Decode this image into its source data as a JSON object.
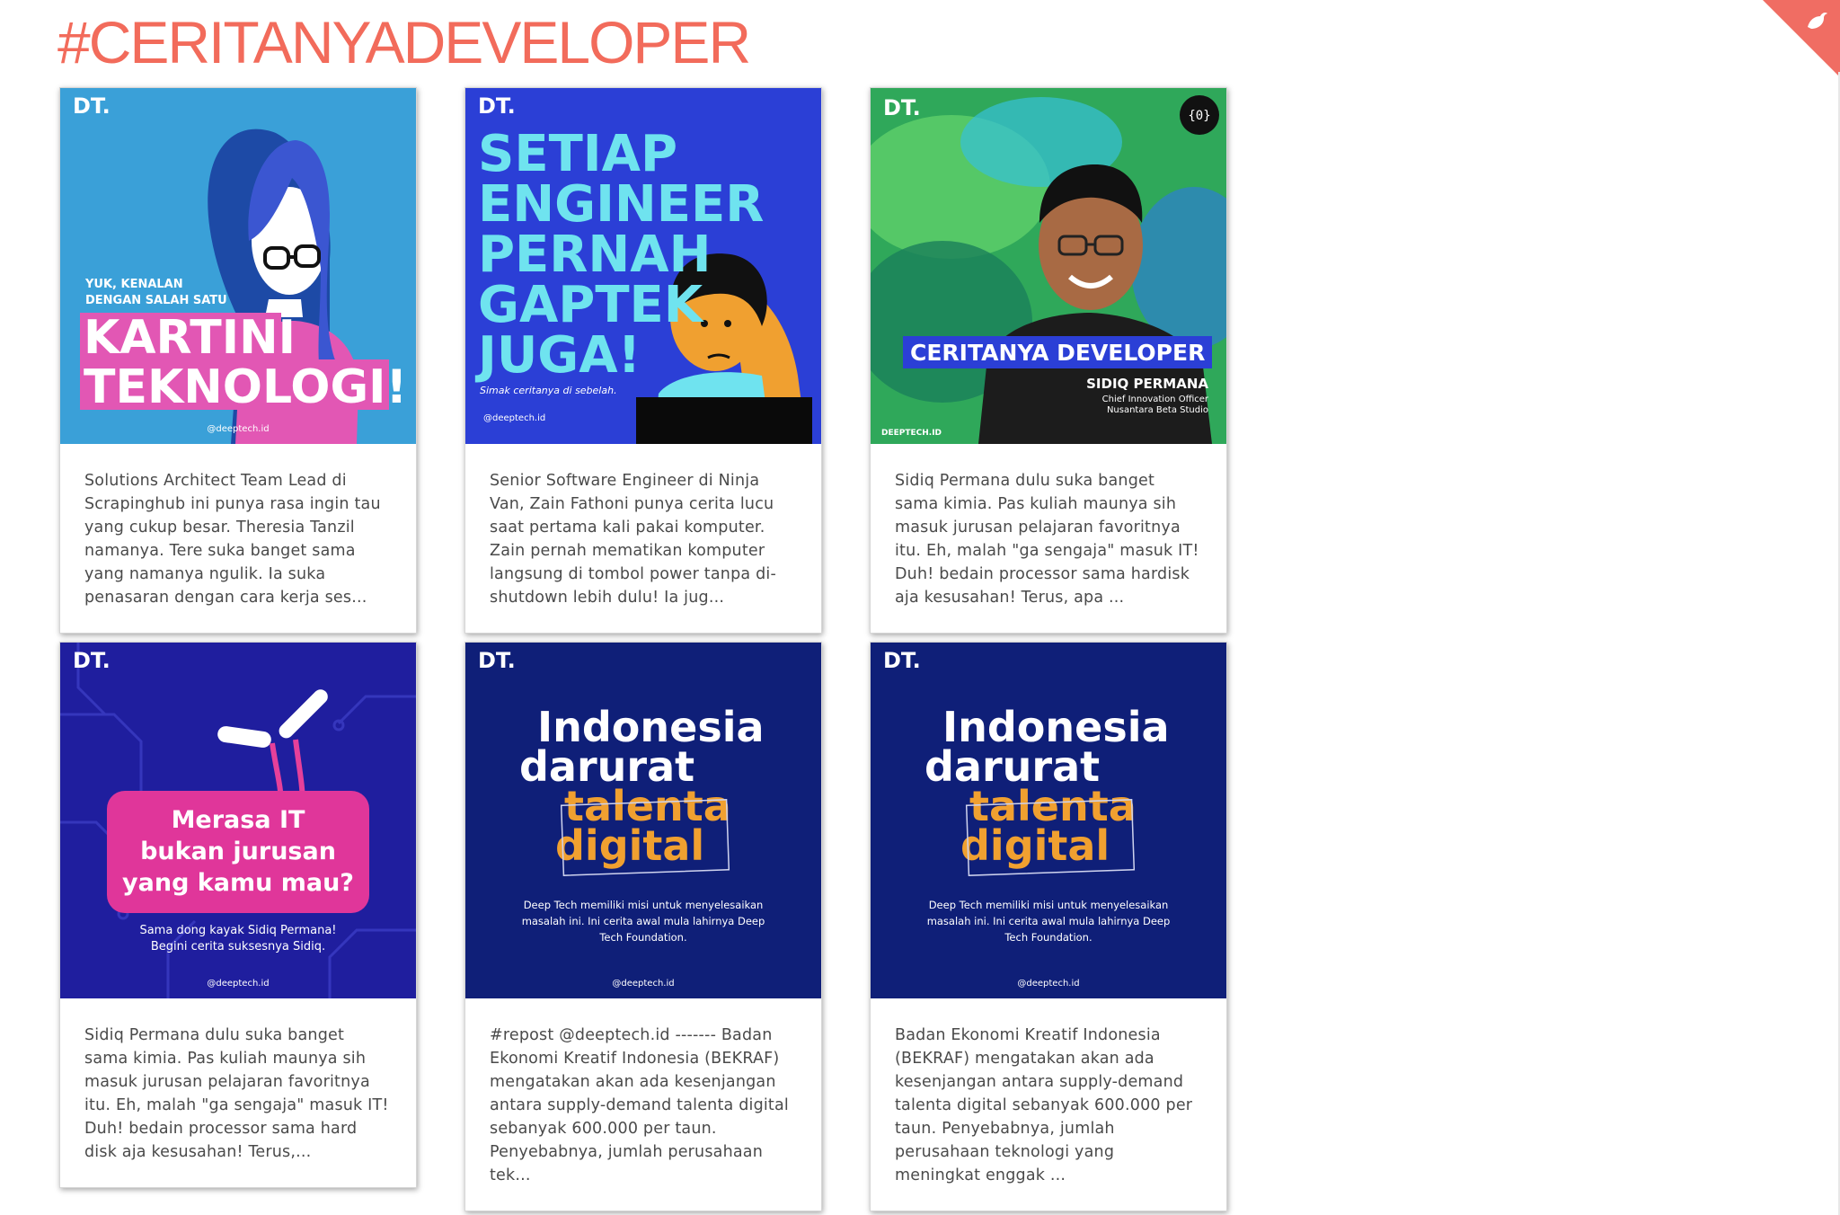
{
  "page": {
    "title": "#CERITANYADEVELOPER",
    "accent_color": "#f26b5b"
  },
  "cards": [
    {
      "image": {
        "logo": "DT.",
        "kicker_line1": "YUK, KENALAN",
        "kicker_line2": "DENGAN SALAH SATU",
        "headline_line1": "KARTINI",
        "headline_line2": "TEKNOLOGI!",
        "handle": "@deeptech.id",
        "background": "#3aa0d8"
      },
      "caption": "Solutions Architect Team Lead di Scrapinghub ini punya rasa ingin tau yang cukup besar. Theresia Tanzil namanya.  Tere suka banget sama yang namanya ngulik. Ia suka penasaran dengan cara kerja ses..."
    },
    {
      "image": {
        "logo": "DT.",
        "headline_line1": "SETIAP",
        "headline_line2": "ENGINEER",
        "headline_line3": "PERNAH",
        "headline_line4": "GAPTEK",
        "headline_line5": "JUGA!",
        "subline": "Simak ceritanya di sebelah.",
        "handle": "@deeptech.id",
        "background": "#2b3fd6"
      },
      "caption": "Senior Software Engineer di Ninja Van, Zain Fathoni punya cerita lucu saat pertama kali pakai komputer.  Zain pernah mematikan komputer langsung di tombol power tanpa di-shutdown lebih dulu! Ia jug..."
    },
    {
      "image": {
        "logo": "DT.",
        "banner": "CERITANYA DEVELOPER",
        "person_name": "SIDIQ PERMANA",
        "person_role_line1": "Chief Innovation Officer",
        "person_role_line2": "Nusantara Beta Studio",
        "footer_logo": "DEEPTECH.ID",
        "badge_text": "{0}",
        "background": "#2fa85a"
      },
      "caption": "Sidiq Permana dulu suka banget sama kimia. Pas kuliah maunya sih masuk jurusan pelajaran favoritnya itu. Eh, malah \"ga sengaja\" masuk IT! Duh! bedain processor sama hardisk aja kesusahan! Terus, apa ..."
    },
    {
      "image": {
        "logo": "DT.",
        "headline_line1": "Merasa IT",
        "headline_line2": "bukan jurusan",
        "headline_line3": "yang kamu mau?",
        "subline1": "Sama dong kayak Sidiq Permana!",
        "subline2": "Begini cerita suksesnya Sidiq.",
        "handle": "@deeptech.id",
        "background": "#1f1e9e"
      },
      "caption": "Sidiq Permana dulu suka banget sama kimia. Pas kuliah maunya sih masuk jurusan pelajaran favoritnya itu. Eh, malah \"ga sengaja\" masuk IT! Duh! bedain processor sama hard disk aja kesusahan!  Terus,..."
    },
    {
      "image": {
        "logo": "DT.",
        "headline_line1": "Indonesia",
        "headline_line2": "darurat",
        "headline_line3": "talenta",
        "headline_line4": "digital",
        "body_line1": "Deep Tech memiliki misi untuk menyelesaikan",
        "body_line2": "masalah ini. Ini cerita awal mula lahirnya Deep",
        "body_line3": "Tech Foundation.",
        "handle": "@deeptech.id",
        "background": "#0f1f78"
      },
      "caption": "#repost @deeptech.id ------- Badan Ekonomi Kreatif Indonesia (BEKRAF) mengatakan akan ada kesenjangan antara supply-demand talenta digital sebanyak 600.000 per taun. Penyebabnya, jumlah perusahaan tek..."
    },
    {
      "image": {
        "logo": "DT.",
        "headline_line1": "Indonesia",
        "headline_line2": "darurat",
        "headline_line3": "talenta",
        "headline_line4": "digital",
        "body_line1": "Deep Tech memiliki misi untuk menyelesaikan",
        "body_line2": "masalah ini. Ini cerita awal mula lahirnya Deep",
        "body_line3": "Tech Foundation.",
        "handle": "@deeptech.id",
        "background": "#0f1f78"
      },
      "caption": "Badan Ekonomi Kreatif Indonesia (BEKRAF) mengatakan akan ada kesenjangan antara supply-demand talenta digital sebanyak 600.000 per taun. Penyebabnya, jumlah perusahaan teknologi yang meningkat enggak ..."
    }
  ]
}
